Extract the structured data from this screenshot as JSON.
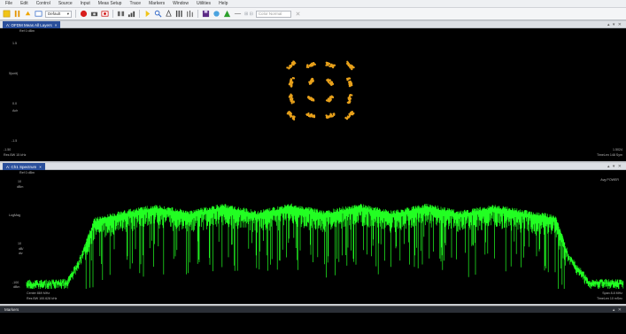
{
  "menu": [
    "File",
    "Edit",
    "Control",
    "Source",
    "Input",
    "Meas Setup",
    "Trace",
    "Markers",
    "Window",
    "Utilities",
    "Help"
  ],
  "toolbar": {
    "preset_label": "Default",
    "filter_placeholder": "Color Normal",
    "icons": [
      "run-icon",
      "pause-icon",
      "preset-icon",
      "record-icon",
      "camera-icon",
      "record-mode-icon",
      "playback-icon",
      "grid-icon",
      "marker-icon",
      "zoom-icon",
      "peak-icon",
      "layout-icon",
      "save-icon",
      "color-icon",
      "spectrum-icon"
    ]
  },
  "panes": {
    "constellation": {
      "tab": "A: OFDM Meas All Layers",
      "ref": "Ref 0 dBm",
      "y_labels": [
        "1.5",
        "5(unit)",
        "0.0",
        "Ach",
        "-1.5"
      ],
      "x_left": "-1.50",
      "x_left_sub": "Res BW 15 kHz",
      "x_right": "1.5024",
      "x_right_sub": "TimeLen 148 Sym",
      "title": ""
    },
    "spectrum": {
      "tab": "A: Ch1 Spectrum",
      "ref": "Ref 0 dBm",
      "y_labels": [
        "10",
        "dBm",
        "LogMag",
        "10",
        "dB/",
        "div",
        "-100",
        "dBm"
      ],
      "avg_label": "Avg POWER",
      "center": "Center 869 MHz",
      "res_bw": "Res BW 100.628 kHz",
      "span": "Span 8.8 MHz",
      "time_len": "TimeLen 10 mSec",
      "title": ""
    },
    "markers": {
      "title": "Markers"
    }
  },
  "chart_data": [
    {
      "type": "scatter",
      "title": "",
      "xlabel": "",
      "ylabel": "",
      "xlim": [
        -1.5,
        1.5
      ],
      "ylim": [
        -1.5,
        1.5
      ],
      "grid": false,
      "legend": "none",
      "color": "#e8a11b",
      "series": [
        {
          "name": "",
          "x": [
            -1.05,
            -0.35,
            0.35,
            1.05,
            -1.05,
            -0.35,
            0.35,
            1.05,
            -1.05,
            -0.35,
            0.35,
            1.05,
            -1.05,
            -0.35,
            0.35,
            1.05
          ],
          "y": [
            1.05,
            1.05,
            1.05,
            1.05,
            0.35,
            0.35,
            0.35,
            0.35,
            -0.35,
            -0.35,
            -0.35,
            -0.35,
            -1.05,
            -1.05,
            -1.05,
            -1.05
          ]
        }
      ]
    },
    {
      "type": "area",
      "title": "",
      "xlabel": "",
      "ylabel": "",
      "x_unit": "MHz",
      "xlim": [
        864.6,
        873.4
      ],
      "ylim": [
        -100,
        10
      ],
      "grid": false,
      "legend": "none",
      "color": "#22ff22",
      "series": [
        {
          "name": "",
          "x": [
            864.6,
            864.9,
            865.2,
            865.4,
            865.6,
            866.0,
            866.5,
            867.0,
            867.5,
            868.0,
            868.5,
            869.0,
            869.5,
            870.0,
            870.5,
            871.0,
            871.5,
            872.0,
            872.4,
            872.6,
            872.9,
            873.4
          ],
          "y": [
            -95,
            -95,
            -94,
            -70,
            -35,
            -28,
            -22,
            -28,
            -21,
            -28,
            -21,
            -28,
            -21,
            -28,
            -21,
            -28,
            -22,
            -28,
            -32,
            -70,
            -94,
            -95
          ]
        }
      ]
    }
  ],
  "colors": {
    "accent": "#2a4f9b",
    "trace": "#22ff22",
    "constellation": "#e8a11b"
  }
}
